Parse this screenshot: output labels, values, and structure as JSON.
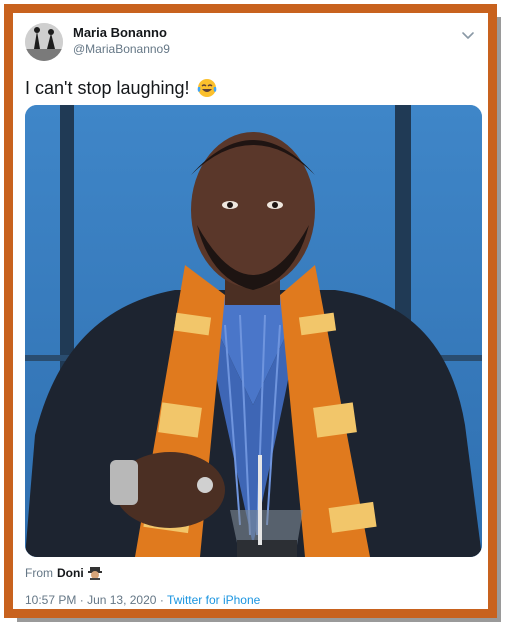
{
  "user": {
    "display_name": "Maria Bonanno",
    "handle": "@MariaBonanno9",
    "avatar_icon": "avatar-image"
  },
  "menu": {
    "icon": "chevron-down-icon"
  },
  "tweet": {
    "text": "I can't stop laughing!",
    "emoji_icon": "tears-of-joy-emoji"
  },
  "media": {
    "type": "video-still"
  },
  "source": {
    "from_label": "From",
    "from_name": "Doni",
    "from_icon": "spy-emoji"
  },
  "meta": {
    "time": "10:57 PM",
    "separator": "·",
    "date": "Jun 13, 2020",
    "client_separator": "·",
    "client": "Twitter for iPhone"
  },
  "colors": {
    "border": "#c8621e",
    "link": "#1b95e0",
    "text_primary": "#14171a",
    "text_secondary": "#657786"
  }
}
